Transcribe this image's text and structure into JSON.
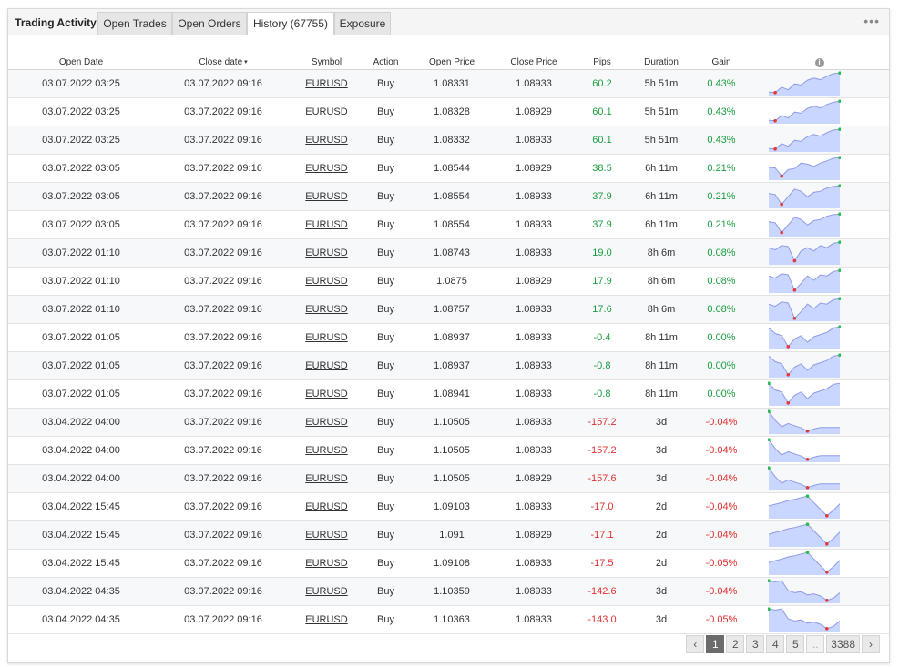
{
  "tabs": {
    "title": "Trading Activity",
    "open_trades": "Open Trades",
    "open_orders": "Open Orders",
    "history": "History (67755)",
    "exposure": "Exposure"
  },
  "menu_icon": "more-dots-icon",
  "colors": {
    "positive": "#1b9e3e",
    "negative": "#e03030",
    "spark_line": "#8f9be8",
    "spark_fill": "#c9d6ff"
  },
  "columns": [
    "Open Date",
    "Close date",
    "Symbol",
    "Action",
    "Open Price",
    "Close Price",
    "Pips",
    "Duration",
    "Gain"
  ],
  "sort_indicator": "▾",
  "info_icon_glyph": "i",
  "rows": [
    {
      "open": "03.07.2022 03:25",
      "close": "03.07.2022 09:16",
      "symbol": "EURUSD",
      "action": "Buy",
      "open_price": "1.08331",
      "close_price": "1.08933",
      "pips": "60.2",
      "duration": "5h 51m",
      "gain": "0.43%",
      "trend": "pos",
      "spark": [
        0.92,
        0.95,
        0.7,
        0.82,
        0.55,
        0.6,
        0.38,
        0.28,
        0.36,
        0.2,
        0.08,
        0.05
      ]
    },
    {
      "open": "03.07.2022 03:25",
      "close": "03.07.2022 09:16",
      "symbol": "EURUSD",
      "action": "Buy",
      "open_price": "1.08328",
      "close_price": "1.08929",
      "pips": "60.1",
      "duration": "5h 51m",
      "gain": "0.43%",
      "trend": "pos",
      "spark": [
        0.92,
        0.95,
        0.7,
        0.82,
        0.55,
        0.6,
        0.38,
        0.28,
        0.36,
        0.2,
        0.1,
        0.05
      ]
    },
    {
      "open": "03.07.2022 03:25",
      "close": "03.07.2022 09:16",
      "symbol": "EURUSD",
      "action": "Buy",
      "open_price": "1.08332",
      "close_price": "1.08933",
      "pips": "60.1",
      "duration": "5h 51m",
      "gain": "0.43%",
      "trend": "pos",
      "spark": [
        0.92,
        0.95,
        0.7,
        0.82,
        0.55,
        0.6,
        0.38,
        0.28,
        0.36,
        0.2,
        0.08,
        0.05
      ]
    },
    {
      "open": "03.07.2022 03:05",
      "close": "03.07.2022 09:16",
      "symbol": "EURUSD",
      "action": "Buy",
      "open_price": "1.08544",
      "close_price": "1.08929",
      "pips": "38.5",
      "duration": "6h 11m",
      "gain": "0.21%",
      "trend": "pos",
      "spark": [
        0.5,
        0.52,
        0.9,
        0.6,
        0.55,
        0.3,
        0.35,
        0.45,
        0.3,
        0.2,
        0.08,
        0.05
      ]
    },
    {
      "open": "03.07.2022 03:05",
      "close": "03.07.2022 09:16",
      "symbol": "EURUSD",
      "action": "Buy",
      "open_price": "1.08554",
      "close_price": "1.08933",
      "pips": "37.9",
      "duration": "6h 11m",
      "gain": "0.21%",
      "trend": "pos",
      "spark": [
        0.4,
        0.45,
        0.9,
        0.55,
        0.2,
        0.3,
        0.55,
        0.35,
        0.3,
        0.15,
        0.08,
        0.05
      ]
    },
    {
      "open": "03.07.2022 03:05",
      "close": "03.07.2022 09:16",
      "symbol": "EURUSD",
      "action": "Buy",
      "open_price": "1.08554",
      "close_price": "1.08933",
      "pips": "37.9",
      "duration": "6h 11m",
      "gain": "0.21%",
      "trend": "pos",
      "spark": [
        0.4,
        0.45,
        0.9,
        0.55,
        0.2,
        0.3,
        0.55,
        0.35,
        0.3,
        0.15,
        0.08,
        0.05
      ]
    },
    {
      "open": "03.07.2022 01:10",
      "close": "03.07.2022 09:16",
      "symbol": "EURUSD",
      "action": "Buy",
      "open_price": "1.08743",
      "close_price": "1.08933",
      "pips": "19.0",
      "duration": "8h 6m",
      "gain": "0.08%",
      "trend": "pos",
      "spark": [
        0.3,
        0.4,
        0.2,
        0.25,
        0.9,
        0.45,
        0.3,
        0.45,
        0.2,
        0.3,
        0.1,
        0.05
      ]
    },
    {
      "open": "03.07.2022 01:10",
      "close": "03.07.2022 09:16",
      "symbol": "EURUSD",
      "action": "Buy",
      "open_price": "1.0875",
      "close_price": "1.08929",
      "pips": "17.9",
      "duration": "8h 6m",
      "gain": "0.08%",
      "trend": "pos",
      "spark": [
        0.3,
        0.4,
        0.2,
        0.25,
        0.95,
        0.65,
        0.3,
        0.5,
        0.25,
        0.3,
        0.1,
        0.05
      ]
    },
    {
      "open": "03.07.2022 01:10",
      "close": "03.07.2022 09:16",
      "symbol": "EURUSD",
      "action": "Buy",
      "open_price": "1.08757",
      "close_price": "1.08933",
      "pips": "17.6",
      "duration": "8h 6m",
      "gain": "0.08%",
      "trend": "pos",
      "spark": [
        0.3,
        0.4,
        0.2,
        0.25,
        0.95,
        0.65,
        0.3,
        0.5,
        0.25,
        0.3,
        0.1,
        0.05
      ]
    },
    {
      "open": "03.07.2022 01:05",
      "close": "03.07.2022 09:16",
      "symbol": "EURUSD",
      "action": "Buy",
      "open_price": "1.08937",
      "close_price": "1.08933",
      "pips": "-0.4",
      "duration": "8h 11m",
      "gain": "0.00%",
      "trend": "pos",
      "spark": [
        0.1,
        0.35,
        0.45,
        0.95,
        0.6,
        0.45,
        0.75,
        0.5,
        0.4,
        0.3,
        0.1,
        0.05
      ]
    },
    {
      "open": "03.07.2022 01:05",
      "close": "03.07.2022 09:16",
      "symbol": "EURUSD",
      "action": "Buy",
      "open_price": "1.08937",
      "close_price": "1.08933",
      "pips": "-0.8",
      "duration": "8h 11m",
      "gain": "0.00%",
      "trend": "pos",
      "spark": [
        0.1,
        0.35,
        0.45,
        0.95,
        0.6,
        0.45,
        0.75,
        0.5,
        0.4,
        0.3,
        0.1,
        0.05
      ]
    },
    {
      "open": "03.07.2022 01:05",
      "close": "03.07.2022 09:16",
      "symbol": "EURUSD",
      "action": "Buy",
      "open_price": "1.08941",
      "close_price": "1.08933",
      "pips": "-0.8",
      "duration": "8h 11m",
      "gain": "0.00%",
      "trend": "pos",
      "spark": [
        0.05,
        0.35,
        0.45,
        0.95,
        0.6,
        0.45,
        0.75,
        0.5,
        0.4,
        0.3,
        0.1,
        0.05
      ]
    },
    {
      "open": "03.04.2022 04:00",
      "close": "03.07.2022 09:16",
      "symbol": "EURUSD",
      "action": "Buy",
      "open_price": "1.10505",
      "close_price": "1.08933",
      "pips": "-157.2",
      "duration": "3d",
      "gain": "-0.04%",
      "trend": "neg",
      "spark": [
        0.05,
        0.45,
        0.75,
        0.6,
        0.7,
        0.8,
        0.95,
        0.85,
        0.78,
        0.78,
        0.78,
        0.78
      ]
    },
    {
      "open": "03.04.2022 04:00",
      "close": "03.07.2022 09:16",
      "symbol": "EURUSD",
      "action": "Buy",
      "open_price": "1.10505",
      "close_price": "1.08933",
      "pips": "-157.2",
      "duration": "3d",
      "gain": "-0.04%",
      "trend": "neg",
      "spark": [
        0.05,
        0.45,
        0.75,
        0.6,
        0.7,
        0.8,
        0.95,
        0.85,
        0.78,
        0.78,
        0.78,
        0.78
      ]
    },
    {
      "open": "03.04.2022 04:00",
      "close": "03.07.2022 09:16",
      "symbol": "EURUSD",
      "action": "Buy",
      "open_price": "1.10505",
      "close_price": "1.08929",
      "pips": "-157.6",
      "duration": "3d",
      "gain": "-0.04%",
      "trend": "neg",
      "spark": [
        0.05,
        0.45,
        0.75,
        0.6,
        0.7,
        0.8,
        0.95,
        0.85,
        0.78,
        0.78,
        0.78,
        0.78
      ]
    },
    {
      "open": "03.04.2022 15:45",
      "close": "03.07.2022 09:16",
      "symbol": "EURUSD",
      "action": "Buy",
      "open_price": "1.09103",
      "close_price": "1.08933",
      "pips": "-17.0",
      "duration": "2d",
      "gain": "-0.04%",
      "trend": "neg",
      "spark": [
        0.5,
        0.42,
        0.35,
        0.25,
        0.2,
        0.12,
        0.05,
        0.35,
        0.65,
        0.95,
        0.7,
        0.4
      ]
    },
    {
      "open": "03.04.2022 15:45",
      "close": "03.07.2022 09:16",
      "symbol": "EURUSD",
      "action": "Buy",
      "open_price": "1.091",
      "close_price": "1.08929",
      "pips": "-17.1",
      "duration": "2d",
      "gain": "-0.04%",
      "trend": "neg",
      "spark": [
        0.5,
        0.42,
        0.35,
        0.25,
        0.2,
        0.12,
        0.05,
        0.35,
        0.65,
        0.95,
        0.7,
        0.4
      ]
    },
    {
      "open": "03.04.2022 15:45",
      "close": "03.07.2022 09:16",
      "symbol": "EURUSD",
      "action": "Buy",
      "open_price": "1.09108",
      "close_price": "1.08933",
      "pips": "-17.5",
      "duration": "2d",
      "gain": "-0.05%",
      "trend": "neg",
      "spark": [
        0.5,
        0.42,
        0.35,
        0.25,
        0.2,
        0.12,
        0.05,
        0.35,
        0.65,
        0.95,
        0.7,
        0.4
      ]
    },
    {
      "open": "03.04.2022 04:35",
      "close": "03.07.2022 09:16",
      "symbol": "EURUSD",
      "action": "Buy",
      "open_price": "1.10359",
      "close_price": "1.08933",
      "pips": "-142.6",
      "duration": "3d",
      "gain": "-0.04%",
      "trend": "neg",
      "spark": [
        0.05,
        0.1,
        0.05,
        0.5,
        0.6,
        0.55,
        0.7,
        0.65,
        0.75,
        0.95,
        0.85,
        0.6
      ]
    },
    {
      "open": "03.04.2022 04:35",
      "close": "03.07.2022 09:16",
      "symbol": "EURUSD",
      "action": "Buy",
      "open_price": "1.10363",
      "close_price": "1.08933",
      "pips": "-143.0",
      "duration": "3d",
      "gain": "-0.05%",
      "trend": "neg",
      "spark": [
        0.05,
        0.1,
        0.05,
        0.5,
        0.6,
        0.55,
        0.7,
        0.65,
        0.75,
        0.95,
        0.85,
        0.6
      ]
    }
  ],
  "pager": {
    "prev": "‹",
    "pages": [
      "1",
      "2",
      "3",
      "4",
      "5"
    ],
    "current": "1",
    "ellipsis": "..",
    "last": "3388",
    "next": "›"
  }
}
